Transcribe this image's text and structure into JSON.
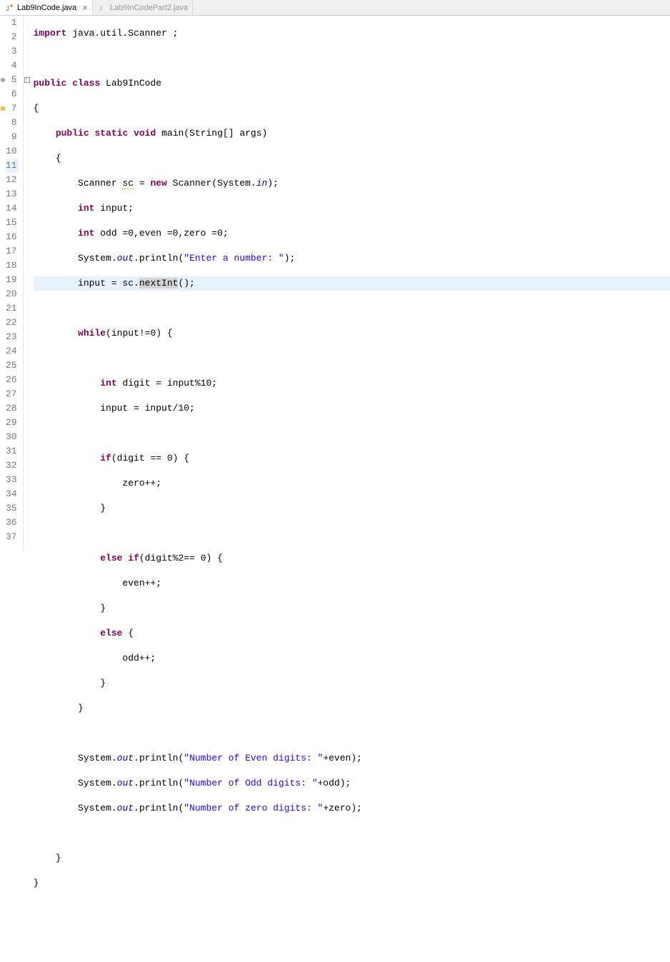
{
  "tabs": [
    {
      "label": "Lab9InCode.java",
      "active": true
    },
    {
      "label": "Lab9InCodePart2.java",
      "active": false
    }
  ],
  "lineNumbers": [
    "1",
    "2",
    "3",
    "4",
    "5",
    "6",
    "7",
    "8",
    "9",
    "10",
    "11",
    "12",
    "13",
    "14",
    "15",
    "16",
    "17",
    "18",
    "19",
    "20",
    "21",
    "22",
    "23",
    "24",
    "25",
    "26",
    "27",
    "28",
    "29",
    "30",
    "31",
    "32",
    "33",
    "34",
    "35",
    "36",
    "37"
  ],
  "code": {
    "l1_kw1": "import",
    "l1_rest": " java.util.Scanner ;",
    "l3_kw1": "public",
    "l3_kw2": "class",
    "l3_cls": " Lab9InCode",
    "l4": "{",
    "l5_kw1": "public",
    "l5_kw2": "static",
    "l5_kw3": "void",
    "l5_rest": " main(String[] args)",
    "l6": "    {",
    "l7_a": "        Scanner ",
    "l7_sc": "sc",
    "l7_b": " = ",
    "l7_kw": "new",
    "l7_c": " Scanner(System.",
    "l7_in": "in",
    "l7_d": ");",
    "l8_kw": "int",
    "l8_rest": " input;",
    "l9_kw": "int",
    "l9_rest": " odd =0,even =0,zero =0;",
    "l10_a": "        System.",
    "l10_out": "out",
    "l10_b": ".println(",
    "l10_str": "\"Enter a number: \"",
    "l10_c": ");",
    "l11_a": "        input = sc.",
    "l11_sel": "nextInt",
    "l11_b": "();",
    "l13_kw": "while",
    "l13_rest": "(input!=0) {",
    "l15_kw": "int",
    "l15_rest": " digit = input%10;",
    "l16": "            input = input/10;",
    "l18_kw": "if",
    "l18_rest": "(digit == 0) {",
    "l19": "                zero++;",
    "l20": "            }",
    "l22_kw1": "else",
    "l22_kw2": "if",
    "l22_rest": "(digit%2== 0) {",
    "l23": "                even++;",
    "l24": "            }",
    "l25_kw": "else",
    "l25_rest": " {",
    "l26": "                odd++;",
    "l27": "            }",
    "l28": "        }",
    "l30_a": "        System.",
    "l30_out": "out",
    "l30_b": ".println(",
    "l30_str": "\"Number of Even digits: \"",
    "l30_c": "+even);",
    "l31_a": "        System.",
    "l31_out": "out",
    "l31_b": ".println(",
    "l31_str": "\"Number of Odd digits: \"",
    "l31_c": "+odd);",
    "l32_a": "        System.",
    "l32_out": "out",
    "l32_b": ".println(",
    "l32_str": "\"Number of zero digits: \"",
    "l32_c": "+zero);",
    "l34": "    }",
    "l35": "}"
  }
}
